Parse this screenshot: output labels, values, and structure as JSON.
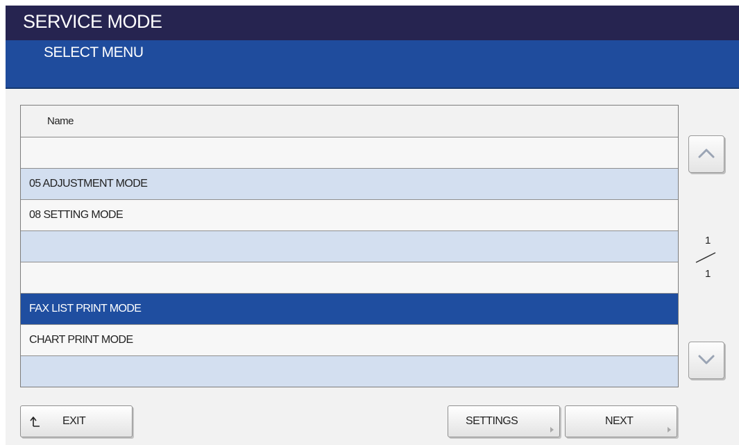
{
  "header": {
    "title": "SERVICE MODE",
    "subtitle": "SELECT MENU"
  },
  "list": {
    "column_header": "Name",
    "rows": [
      {
        "label": "",
        "state": "white"
      },
      {
        "label": "05 ADJUSTMENT MODE",
        "state": "blue"
      },
      {
        "label": "08 SETTING MODE",
        "state": "white"
      },
      {
        "label": "",
        "state": "blue"
      },
      {
        "label": "",
        "state": "white"
      },
      {
        "label": "FAX LIST PRINT MODE",
        "state": "selected"
      },
      {
        "label": "CHART PRINT MODE",
        "state": "white"
      },
      {
        "label": "",
        "state": "blue"
      }
    ]
  },
  "pagination": {
    "current": "1",
    "total": "1",
    "up_icon": "chevron-up-icon",
    "down_icon": "chevron-down-icon"
  },
  "footer": {
    "exit_label": "EXIT",
    "exit_icon": "return-arrow-icon",
    "settings_label": "SETTINGS",
    "next_label": "NEXT"
  },
  "colors": {
    "title_bar": "#262450",
    "sub_bar": "#1f4c9d",
    "row_blue": "#d3dff0",
    "row_selected": "#1f4ea0"
  }
}
